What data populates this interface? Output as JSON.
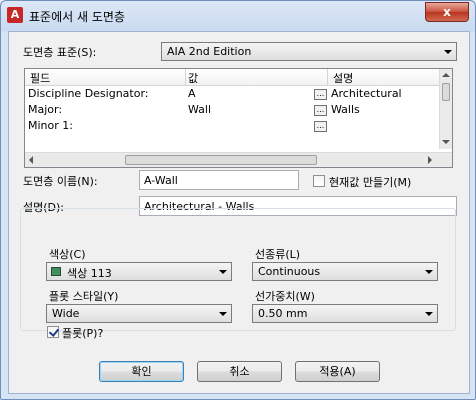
{
  "window": {
    "title": "표준에서 새 도면층",
    "app_icon": "autocad-icon",
    "close_icon": "close-icon",
    "close_glyph": "x"
  },
  "layer_standard": {
    "label": "도면층 표준(S):",
    "value": "AIA 2nd Edition"
  },
  "grid": {
    "columns": [
      "필드",
      "값",
      "설명"
    ],
    "rows": [
      {
        "field": "Discipline Designator:",
        "value": "A",
        "desc": "Architectural"
      },
      {
        "field": "Major:",
        "value": "Wall",
        "desc": "Walls"
      },
      {
        "field": "Minor 1:",
        "value": "",
        "desc": ""
      }
    ],
    "browse_glyph": "..."
  },
  "layer_name": {
    "label": "도면층 이름(N):",
    "value": "A-Wall"
  },
  "make_current": {
    "label": "현재값 만들기(M)",
    "checked": false
  },
  "description": {
    "label": "설명(D):",
    "value": "Architectural - Walls"
  },
  "properties": {
    "color_label": "색상(C)",
    "color_value": "색상 113",
    "color_swatch": "#3f8f5f",
    "linetype_label": "선종류(L)",
    "linetype_value": "Continuous",
    "plotstyle_label": "플롯 스타일(Y)",
    "plotstyle_value": "Wide",
    "lineweight_label": "선가중치(W)",
    "lineweight_value": "0.50 mm",
    "plot_label": "플롯(P)?",
    "plot_checked": true
  },
  "buttons": {
    "ok": "확인",
    "cancel": "취소",
    "apply": "적용(A)"
  }
}
